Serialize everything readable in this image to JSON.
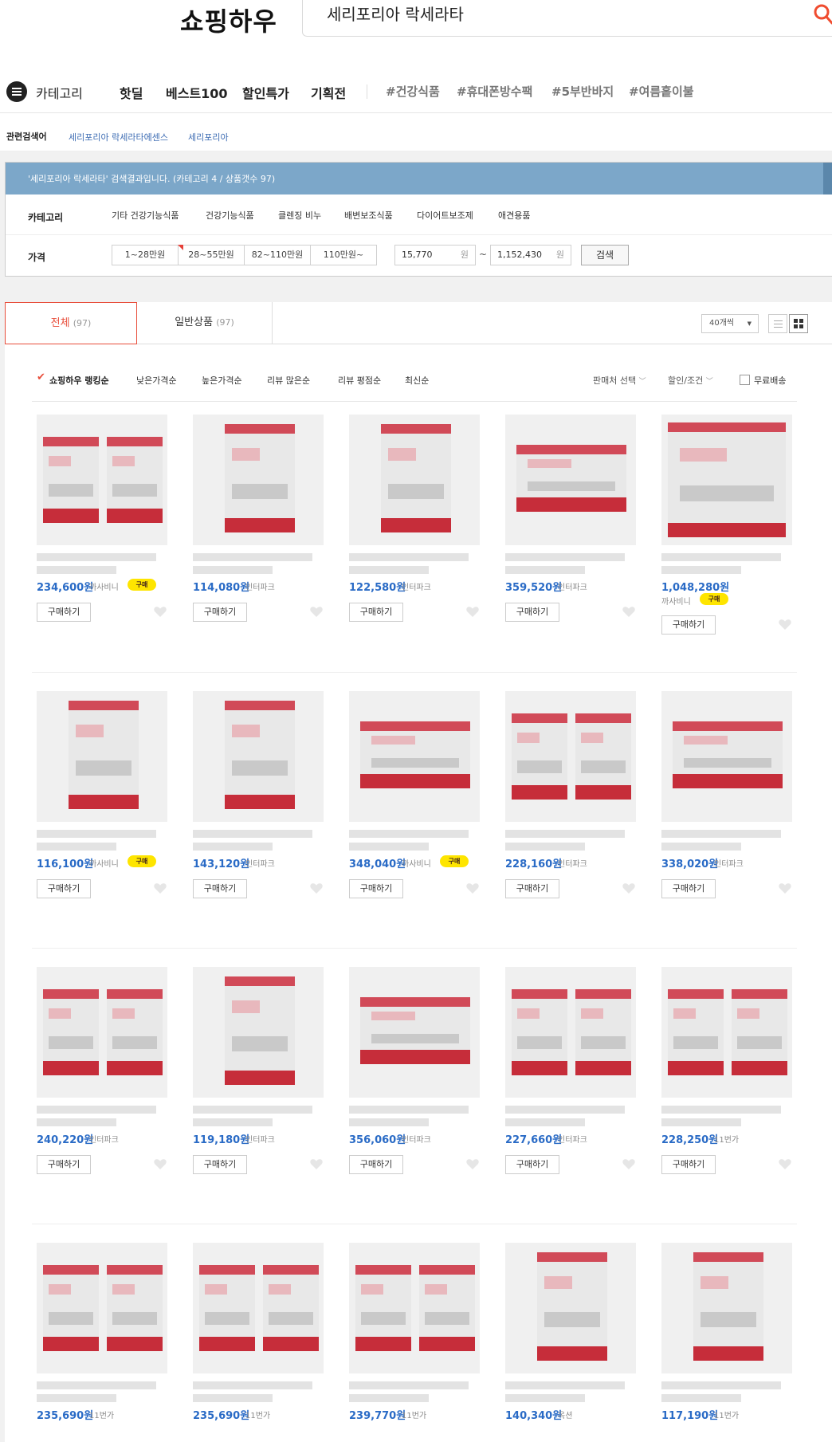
{
  "header": {
    "logo": "쇼핑하우",
    "search_value": "세리포리아 락세라타"
  },
  "gnb": {
    "category_label": "카테고리",
    "items": [
      "핫딜",
      "베스트100",
      "할인특가",
      "기획전"
    ],
    "tags": [
      "#건강식품",
      "#휴대폰방수팩",
      "#5부반바지",
      "#여름홑이불"
    ]
  },
  "related": {
    "label": "관련검색어",
    "links": [
      "세리포리아 락세라타에센스",
      "세리포리아"
    ]
  },
  "filter": {
    "summary": "'세리포리아 락세라타' 검색결과입니다. (카테고리 4 / 상품갯수 97)",
    "category_label": "카테고리",
    "categories": [
      "기타 건강기능식품",
      "건강기능식품",
      "클렌징 비누",
      "배변보조식품",
      "다이어트보조제",
      "애견용품"
    ],
    "price_label": "가격",
    "price_ranges": [
      "1~28만원",
      "28~55만원",
      "82~110만원",
      "110만원~"
    ],
    "price_min": "15,770",
    "price_max": "1,152,430",
    "won": "원",
    "tilde": "~",
    "search_button": "검색"
  },
  "results": {
    "tab_all": "전체",
    "tab_all_count": "(97)",
    "tab_general": "일반상품",
    "tab_general_count": "(97)",
    "per_page": "40개씩",
    "sort_options": [
      "쇼핑하우 랭킹순",
      "낮은가격순",
      "높은가격순",
      "리뷰 많은순",
      "리뷰 평점순",
      "최신순"
    ],
    "seller_filter": "판매처 선택",
    "discount_filter": "할인/조건",
    "free_shipping": "무료배송",
    "buy_label": "구매하기",
    "chat_badge": "구매"
  },
  "products": [
    {
      "price": "234,600원",
      "seller": "까사비니",
      "chat": true,
      "style": "double"
    },
    {
      "price": "114,080원",
      "seller": "인터파크",
      "chat": false,
      "style": "single"
    },
    {
      "price": "122,580원",
      "seller": "인터파크",
      "chat": false,
      "style": "single"
    },
    {
      "price": "359,520원",
      "seller": "인터파크",
      "chat": false,
      "style": "wide"
    },
    {
      "price": "1,048,280원",
      "seller": "까사비니",
      "chat": true,
      "style": "stack",
      "wrap": true
    },
    {
      "price": "116,100원",
      "seller": "까사비니",
      "chat": true,
      "style": "single"
    },
    {
      "price": "143,120원",
      "seller": "인터파크",
      "chat": false,
      "style": "single"
    },
    {
      "price": "348,040원",
      "seller": "까사비니",
      "chat": true,
      "style": "wide"
    },
    {
      "price": "228,160원",
      "seller": "인터파크",
      "chat": false,
      "style": "double"
    },
    {
      "price": "338,020원",
      "seller": "인터파크",
      "chat": false,
      "style": "wide"
    },
    {
      "price": "240,220원",
      "seller": "인터파크",
      "chat": false,
      "style": "double"
    },
    {
      "price": "119,180원",
      "seller": "인터파크",
      "chat": false,
      "style": "single"
    },
    {
      "price": "356,060원",
      "seller": "인터파크",
      "chat": false,
      "style": "wide"
    },
    {
      "price": "227,660원",
      "seller": "인터파크",
      "chat": false,
      "style": "double"
    },
    {
      "price": "228,250원",
      "seller": "11번가",
      "chat": false,
      "style": "double"
    },
    {
      "price": "235,690원",
      "seller": "11번가",
      "chat": false,
      "style": "double",
      "partial": true
    },
    {
      "price": "235,690원",
      "seller": "11번가",
      "chat": false,
      "style": "double",
      "partial": true
    },
    {
      "price": "239,770원",
      "seller": "11번가",
      "chat": false,
      "style": "double",
      "partial": true
    },
    {
      "price": "140,340원",
      "seller": "옥션",
      "chat": false,
      "style": "single",
      "partial": true
    },
    {
      "price": "117,190원",
      "seller": "11번가",
      "chat": false,
      "style": "single",
      "partial": true
    }
  ],
  "colors": {
    "price_blue": "#2a6bc6",
    "accent_red": "#e84e3b",
    "filter_head": "#7ca7c9",
    "chat_yellow": "#fee500"
  }
}
